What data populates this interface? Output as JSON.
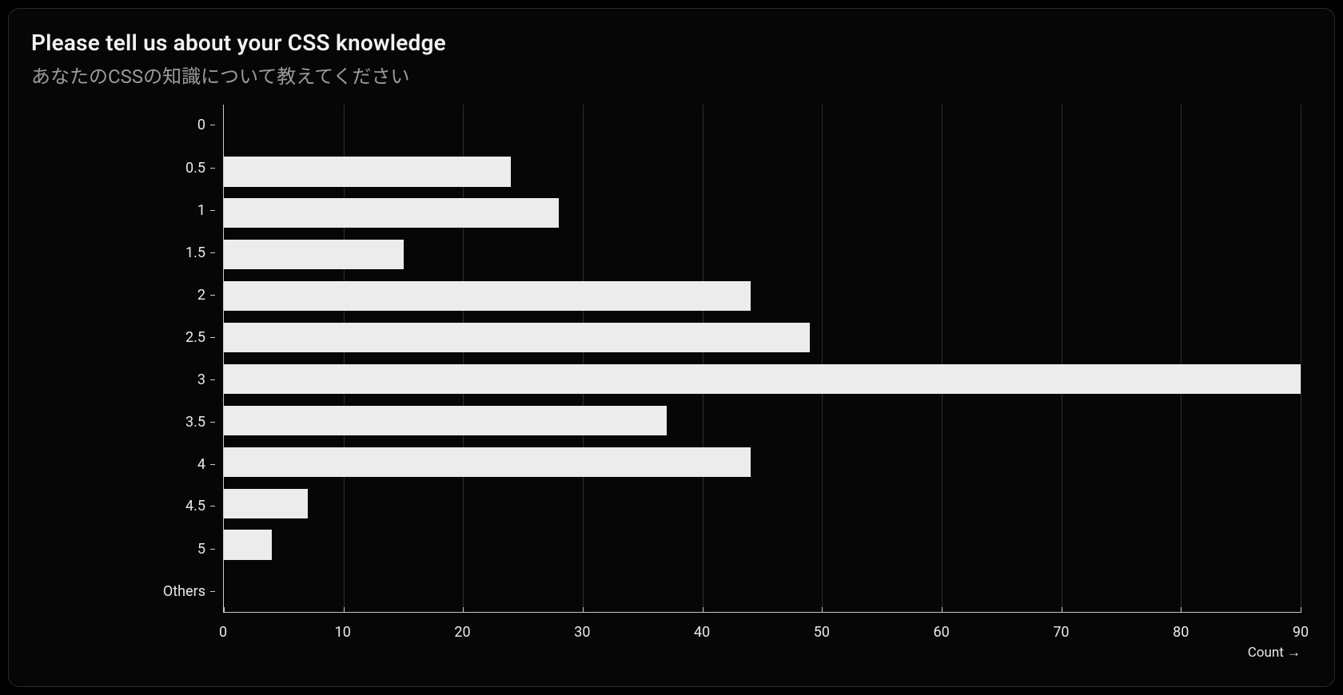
{
  "title": "Please tell us about your CSS knowledge",
  "subtitle": "あなたのCSSの知識について教えてください",
  "axis": {
    "x_title": "Count →"
  },
  "chart_data": {
    "type": "bar",
    "orientation": "horizontal",
    "categories": [
      "0",
      "0.5",
      "1",
      "1.5",
      "2",
      "2.5",
      "3",
      "3.5",
      "4",
      "4.5",
      "5",
      "Others"
    ],
    "values": [
      0,
      24,
      28,
      15,
      44,
      49,
      90,
      37,
      44,
      7,
      4,
      0
    ],
    "xlabel": "Count →",
    "ylabel": "",
    "xlim": [
      0,
      90
    ],
    "x_ticks": [
      0,
      10,
      20,
      30,
      40,
      50,
      60,
      70,
      80,
      90
    ],
    "title": "Please tell us about your CSS knowledge",
    "subtitle": "あなたのCSSの知識について教えてください"
  }
}
